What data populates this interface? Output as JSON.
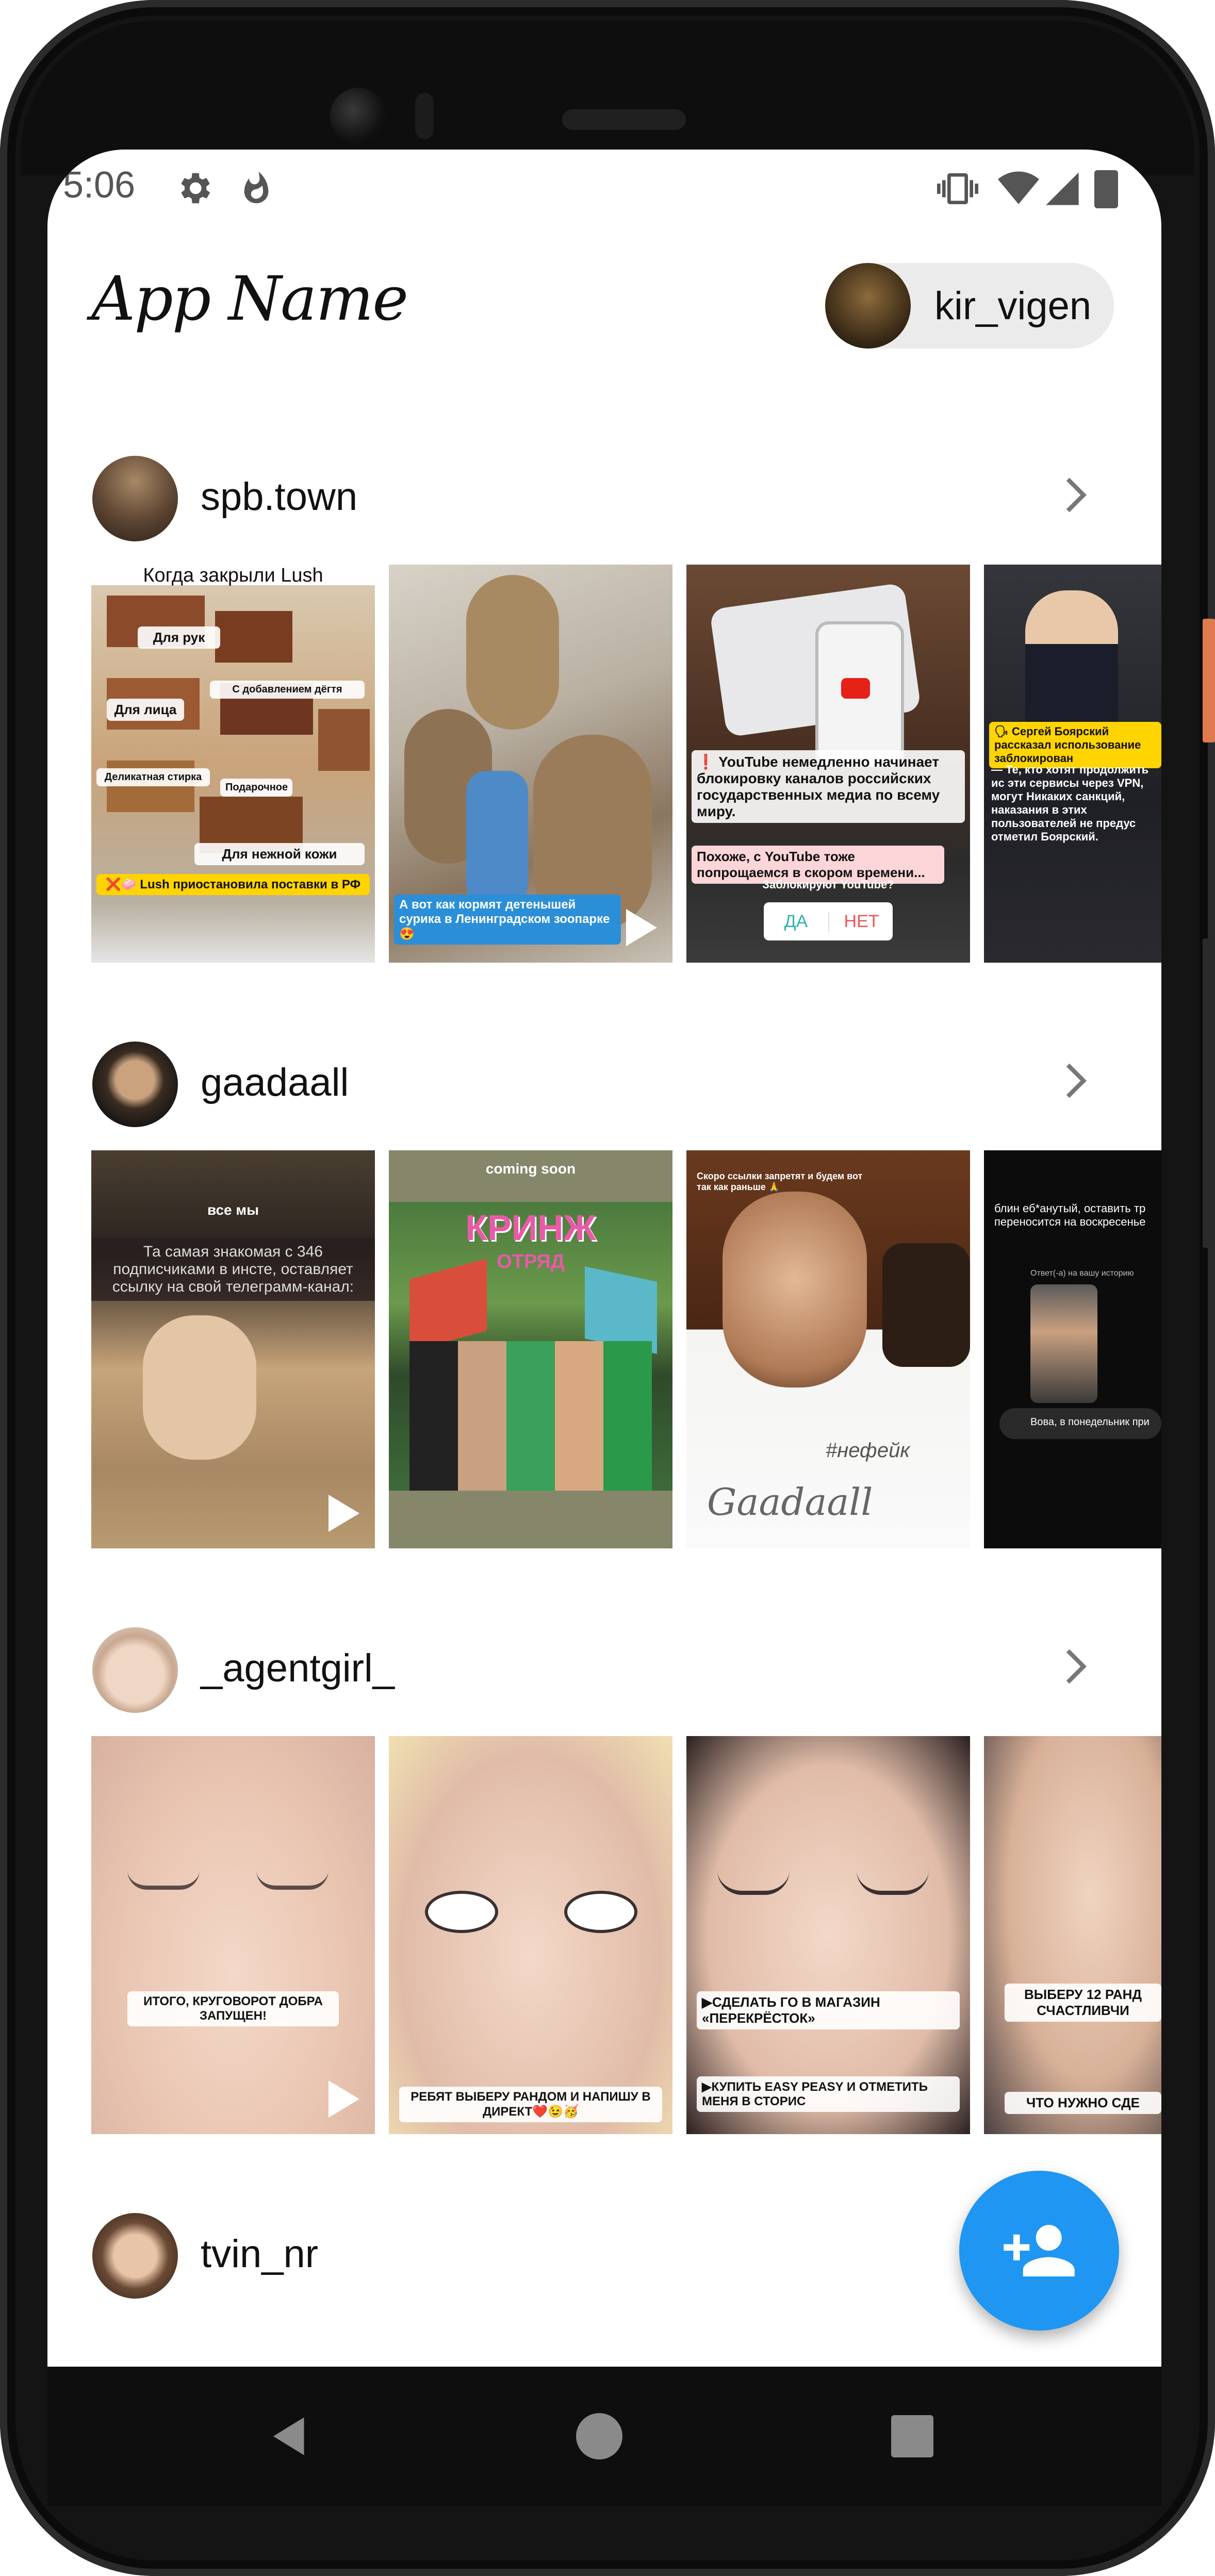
{
  "status": {
    "time": "5:06"
  },
  "header": {
    "app_title": "App Name",
    "username": "kir_vigen"
  },
  "feeds": [
    {
      "name": "spb.town",
      "stories": [
        {
          "top": "Когда закрыли Lush",
          "labels": [
            "Для рук",
            "Для лица",
            "С добавлением дёгтя",
            "Деликатная стирка",
            "Подарочное",
            "Для нежной кожи"
          ],
          "bottom": "❌🧼 Lush приостановила поставки в РФ"
        },
        {
          "bottom": "А вот как кормят детенышей сурика в Ленинградском зоопарке😍"
        },
        {
          "text": "❗ YouTube немедленно начинает блокировку каналов российских государственных медиа по всему миру.",
          "sub": "Похоже, с YouTube тоже попрощаемся в скором времени...",
          "poll_q": "Заблокируют YouTube?",
          "yes": "ДА",
          "no": "НЕТ"
        },
        {
          "text": "🗣 Сергей Боярский рассказал использование заблокирован",
          "sub": "— Те, кто хотят продолжить ис эти сервисы через VPN, могут Никаких санкций, наказания в этих пользователей не предус отметил Боярский."
        }
      ]
    },
    {
      "name": "gaadaall",
      "stories": [
        {
          "top": "все мы",
          "text": "Та самая знакомая с 346 подписчиками в инсте, оставляет ссылку на свой телеграмм-канал:"
        },
        {
          "top": "coming soon",
          "title": "КРИНЖ",
          "sub": "ОТРЯД"
        },
        {
          "top": "Скоро ссылки запретят и будем вот так как раньше 🙏",
          "hashtag": "#нефейк",
          "sign": "Gaadaall"
        },
        {
          "text": "блин еб*анутый, оставить тр переносится на воскресенье",
          "reply_label": "Ответ(-а) на вашу историю",
          "reply": "Вова, в понедельник при"
        }
      ]
    },
    {
      "name": "_agentgirl_",
      "stories": [
        {
          "bottom": "ИТОГО, КРУГОВОРОТ ДОБРА ЗАПУЩЕН!"
        },
        {
          "bottom": "РЕБЯТ ВЫБЕРУ РАНДОМ И НАПИШУ В ДИРЕКТ❤️😉🥳"
        },
        {
          "top": "▶СДЕЛАТЬ ГО В МАГАЗИН «ПЕРЕКРЁСТОК»",
          "bottom": "▶КУПИТЬ EASY PEASY И ОТМЕТИТЬ МЕНЯ В СТОРИС"
        },
        {
          "top": "ВЫБЕРУ 12 РАНД СЧАСТЛИВЧИ",
          "bottom": "ЧТО НУЖНО СДЕ"
        }
      ]
    },
    {
      "name": "tvin_nr"
    }
  ],
  "icons": {
    "fab": "person-add-icon",
    "chevron": "chevron-right-icon"
  },
  "colors": {
    "accent": "#1e96f2"
  }
}
